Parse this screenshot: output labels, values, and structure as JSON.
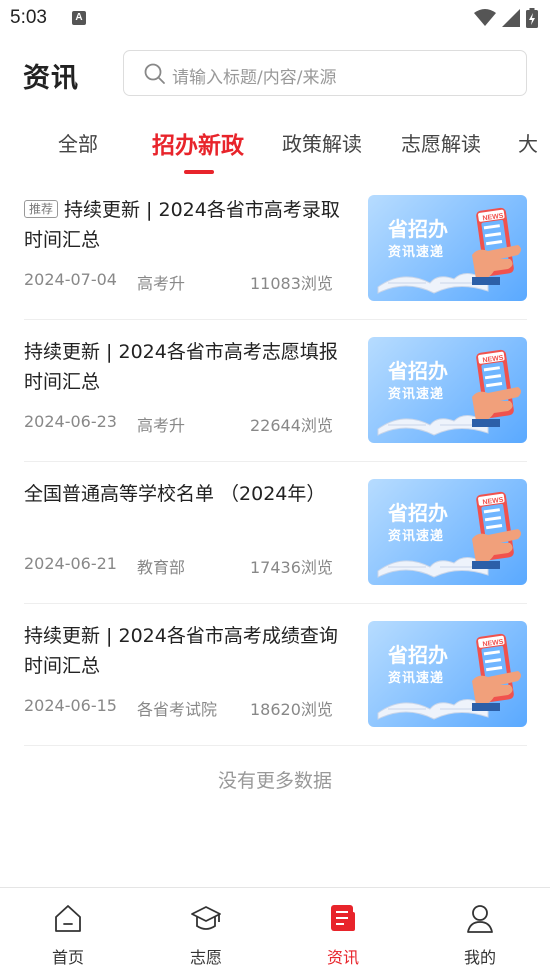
{
  "status_bar": {
    "time": "5:03",
    "notification_icon": "A"
  },
  "header": {
    "title": "资讯"
  },
  "search": {
    "placeholder": "请输入标题/内容/来源"
  },
  "tabs": [
    {
      "label": "全部"
    },
    {
      "label": "招办新政",
      "active": true
    },
    {
      "label": "政策解读"
    },
    {
      "label": "志愿解读"
    },
    {
      "label": "大"
    }
  ],
  "news": [
    {
      "badge": "推荐",
      "title": "持续更新 | 2024各省市高考录取时间汇总",
      "date": "2024-07-04",
      "source": "高考升",
      "views": "11083浏览",
      "thumb": {
        "line1": "省招办",
        "line2": "资讯速递",
        "tag": "NEWS"
      }
    },
    {
      "title": "持续更新 | 2024各省市高考志愿填报时间汇总",
      "date": "2024-06-23",
      "source": "高考升",
      "views": "22644浏览",
      "thumb": {
        "line1": "省招办",
        "line2": "资讯速递",
        "tag": "NEWS"
      }
    },
    {
      "title": "全国普通高等学校名单 （2024年）",
      "date": "2024-06-21",
      "source": "教育部",
      "views": "17436浏览",
      "thumb": {
        "line1": "省招办",
        "line2": "资讯速递",
        "tag": "NEWS"
      }
    },
    {
      "title": "持续更新 | 2024各省市高考成绩查询时间汇总",
      "date": "2024-06-15",
      "source": "各省考试院",
      "views": "18620浏览",
      "thumb": {
        "line1": "省招办",
        "line2": "资讯速递",
        "tag": "NEWS"
      }
    }
  ],
  "list_end_text": "没有更多数据",
  "bottom_nav": [
    {
      "label": "首页",
      "icon": "home-icon"
    },
    {
      "label": "志愿",
      "icon": "graduation-cap-icon"
    },
    {
      "label": "资讯",
      "icon": "news-icon",
      "active": true
    },
    {
      "label": "我的",
      "icon": "user-icon"
    }
  ],
  "colors": {
    "accent": "#e8242b",
    "thumb_blue": "#5aa9ff"
  }
}
